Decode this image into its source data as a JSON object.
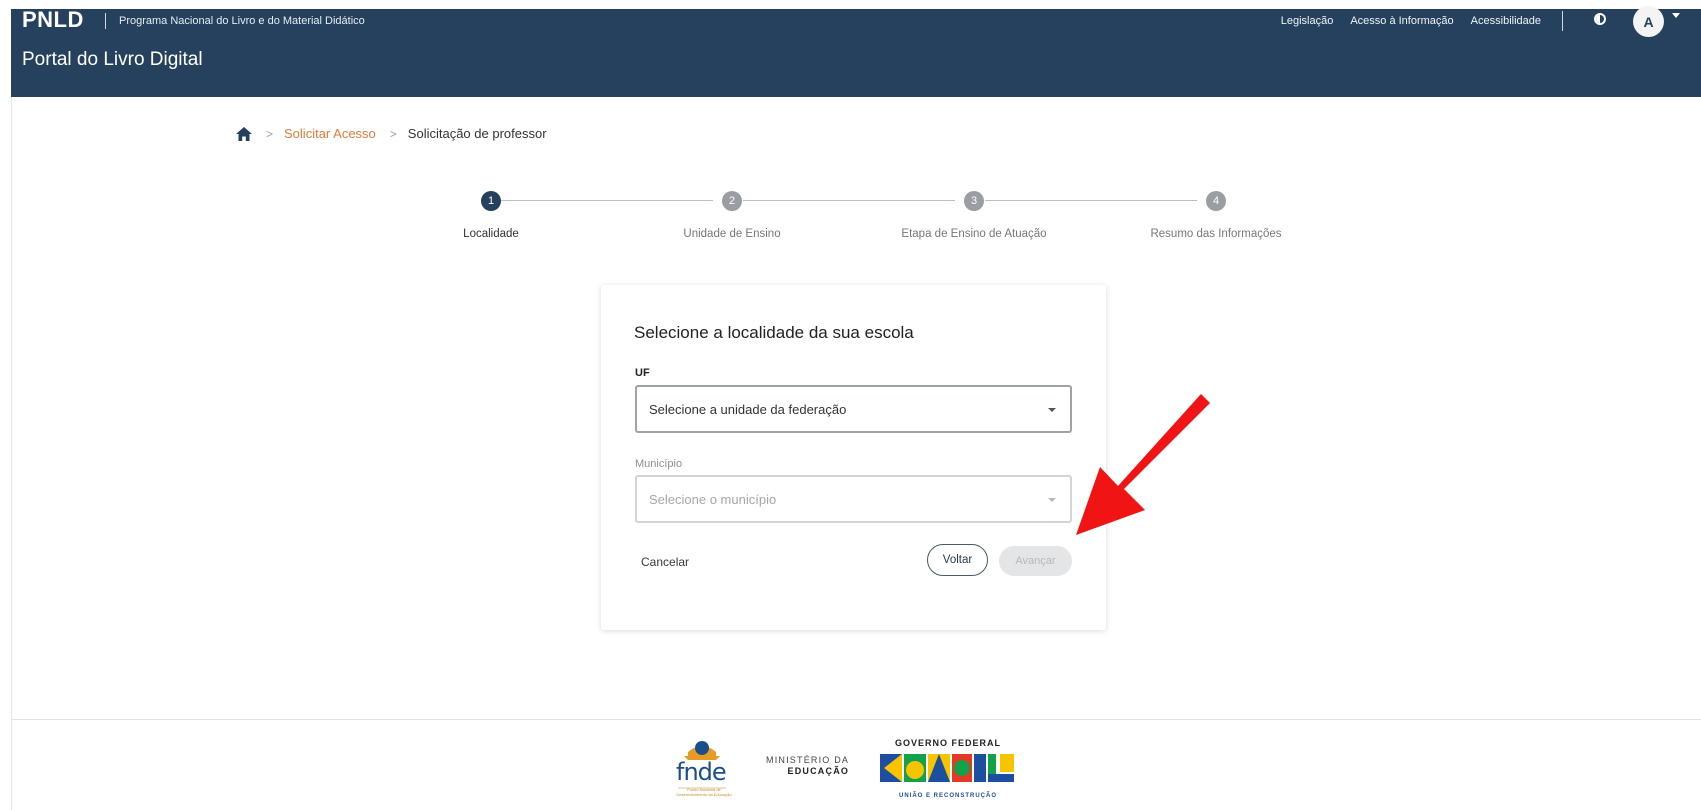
{
  "header": {
    "brand": "PNLD",
    "brand_subtitle": "Programa Nacional do Livro e do Material Didático",
    "portal_title": "Portal do Livro Digital",
    "links": [
      "Legislação",
      "Acesso à Informação",
      "Acessibilidade"
    ],
    "avatar_letter": "A",
    "bg_color": "#25415e"
  },
  "breadcrumb": {
    "home_icon": "home-icon",
    "items": [
      {
        "label": "Solicitar Acesso"
      },
      {
        "label": "Solicitação de professor"
      }
    ],
    "separator": ">"
  },
  "stepper": {
    "steps": [
      {
        "number": "1",
        "label": "Localidade",
        "active": true
      },
      {
        "number": "2",
        "label": "Unidade de Ensino",
        "active": false
      },
      {
        "number": "3",
        "label": "Etapa de Ensino de Atuação",
        "active": false
      },
      {
        "number": "4",
        "label": "Resumo das Informações",
        "active": false
      }
    ],
    "active_color": "#25415e",
    "inactive_color": "#9a9ea3"
  },
  "form": {
    "title": "Selecione a localidade da sua escola",
    "uf": {
      "label": "UF",
      "placeholder": "Selecione a unidade da federação"
    },
    "municipio": {
      "label": "Município",
      "placeholder": "Selecione o município"
    },
    "cancel_label": "Cancelar",
    "back_label": "Voltar",
    "next_label": "Avançar"
  },
  "annotation": {
    "arrow_color": "#f01414"
  },
  "footer": {
    "fnde_logo_text": "fnde",
    "fnde_subtext": "Fundo Nacional de Desenvolvimento da Educação",
    "mec_line1": "MINISTÉRIO DA",
    "mec_line2": "EDUCAÇÃO",
    "gov_top": "GOVERNO FEDERAL",
    "gov_main": "BRASIL",
    "gov_bottom": "UNIÃO E RECONSTRUÇÃO"
  }
}
